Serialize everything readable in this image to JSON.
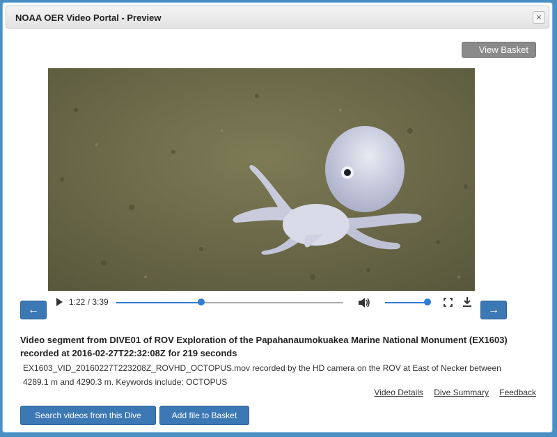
{
  "window": {
    "title": "NOAA OER Video Portal - Preview",
    "close_glyph": "×"
  },
  "toolbar": {
    "view_basket_label": "View Basket"
  },
  "player": {
    "prev_glyph": "←",
    "next_glyph": "→",
    "time_display": "1:22 / 3:39",
    "progress_fraction": 0.374,
    "volume_fraction": 1.0
  },
  "description": {
    "title": "Video segment from DIVE01 of ROV Exploration of the Papahanaumokuakea Marine National Monument (EX1603) recorded at 2016-02-27T22:32:08Z for 219 seconds",
    "body": "EX1603_VID_20160227T223208Z_ROVHD_OCTOPUS.mov recorded by the HD camera on the ROV at East of Necker between 4289.1 m and 4290.3 m. Keywords include: OCTOPUS"
  },
  "links": {
    "video_details": "Video Details",
    "dive_summary": "Dive Summary",
    "feedback": "Feedback"
  },
  "actions": {
    "search_videos": "Search videos from this Dive",
    "add_to_basket": "Add file to Basket"
  },
  "colors": {
    "accent": "#3c78b4",
    "progress": "#2f7bd6",
    "page_bg": "#4a90c4"
  }
}
